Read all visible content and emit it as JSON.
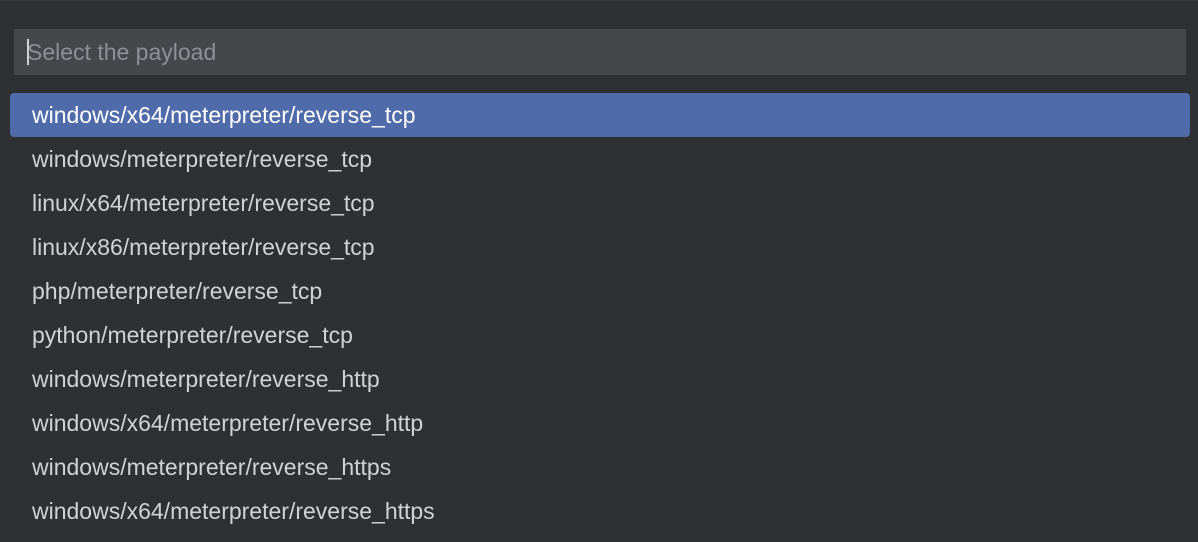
{
  "search": {
    "placeholder": "Select the payload",
    "value": ""
  },
  "payloads": {
    "selected_index": 0,
    "items": [
      "windows/x64/meterpreter/reverse_tcp",
      "windows/meterpreter/reverse_tcp",
      "linux/x64/meterpreter/reverse_tcp",
      "linux/x86/meterpreter/reverse_tcp",
      "php/meterpreter/reverse_tcp",
      "python/meterpreter/reverse_tcp",
      "windows/meterpreter/reverse_http",
      "windows/x64/meterpreter/reverse_http",
      "windows/meterpreter/reverse_https",
      "windows/x64/meterpreter/reverse_https"
    ]
  },
  "colors": {
    "background": "#2f3033",
    "input_background": "#45484b",
    "selection": "#4f6ba9",
    "text": "#d0d2d5",
    "placeholder": "#8d9094"
  }
}
